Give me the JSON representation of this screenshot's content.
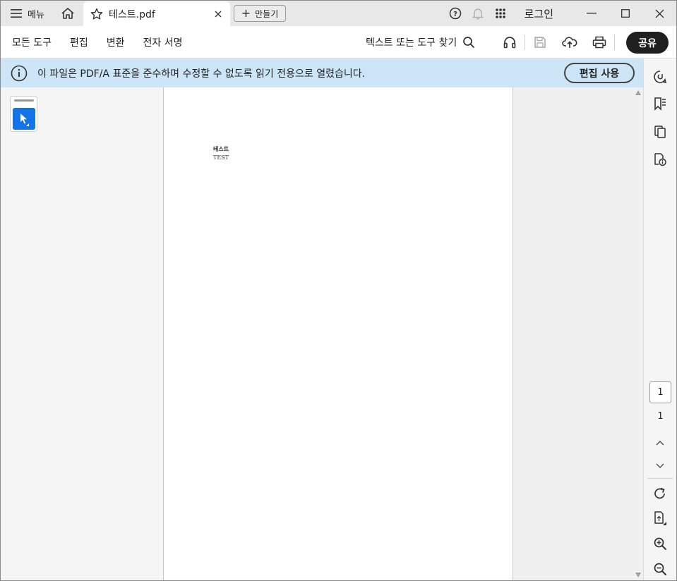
{
  "titlebar": {
    "menu_label": "메뉴",
    "tab_label": "테스트.pdf",
    "create_label": "만들기",
    "login_label": "로그인"
  },
  "toolbar": {
    "menus": [
      "모든 도구",
      "편집",
      "변환",
      "전자 서명"
    ],
    "search_label": "텍스트 또는 도구 찾기",
    "share_label": "공유"
  },
  "infobar": {
    "message": "이 파일은 PDF/A 표준을 준수하며 수정할 수 없도록 읽기 전용으로 열렸습니다.",
    "edit_label": "편집 사용"
  },
  "document": {
    "line1": "테스트",
    "line2": "TEST"
  },
  "pager": {
    "current": "1",
    "total": "1"
  },
  "colors": {
    "accent": "#1473e6",
    "infobar_bg": "#cde6f7"
  }
}
